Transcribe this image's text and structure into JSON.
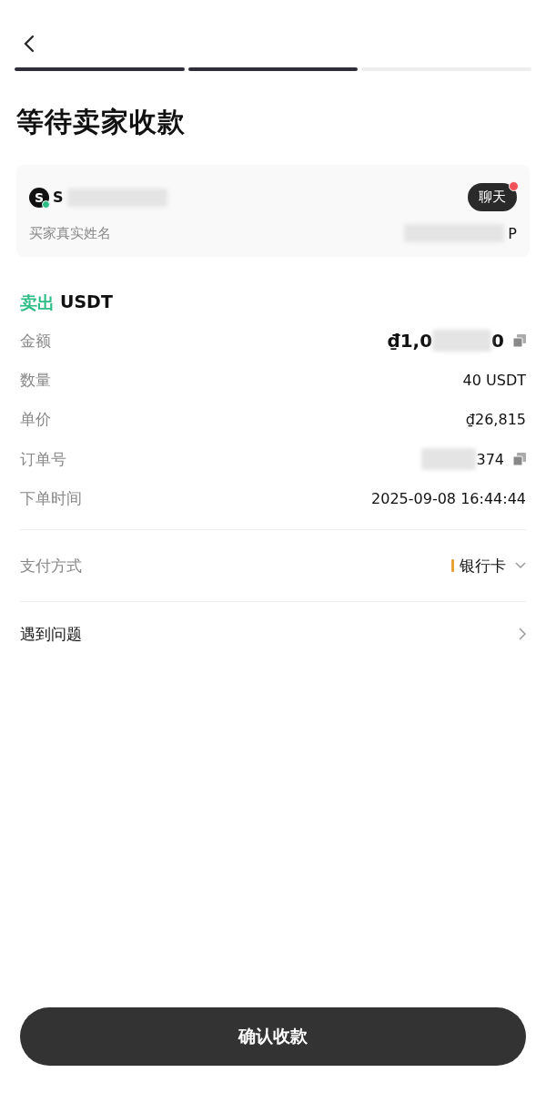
{
  "steps": [
    {
      "done": true
    },
    {
      "done": true
    },
    {
      "done": false
    }
  ],
  "title": "等待卖家收款",
  "counterparty": {
    "avatar_letter": "S",
    "online": true,
    "name_visible": "S",
    "chat_label": "聊天",
    "chat_unread": true,
    "real_name_label": "买家真实姓名",
    "real_name_visible": "P"
  },
  "order": {
    "side": "卖出",
    "asset": "USDT",
    "rows": [
      {
        "label": "金额",
        "value_start": "₫1,0",
        "value_end": "0",
        "redacted": true,
        "emphasis": true,
        "copyable": true
      },
      {
        "label": "数量",
        "value_end": "40 USDT",
        "redacted": false,
        "emphasis": false,
        "copyable": false
      },
      {
        "label": "单价",
        "value_end": "₫26,815",
        "redacted": false,
        "emphasis": false,
        "copyable": false
      },
      {
        "label": "订单号",
        "value_end": "374",
        "redacted": true,
        "emphasis": false,
        "copyable": true
      },
      {
        "label": "下单时间",
        "value_end": "2025-09-08 16:44:44",
        "redacted": false,
        "emphasis": false,
        "copyable": false
      }
    ]
  },
  "payment": {
    "label": "支付方式",
    "value": "银行卡"
  },
  "help": {
    "label": "遇到问题"
  },
  "confirm_button": "确认收款"
}
